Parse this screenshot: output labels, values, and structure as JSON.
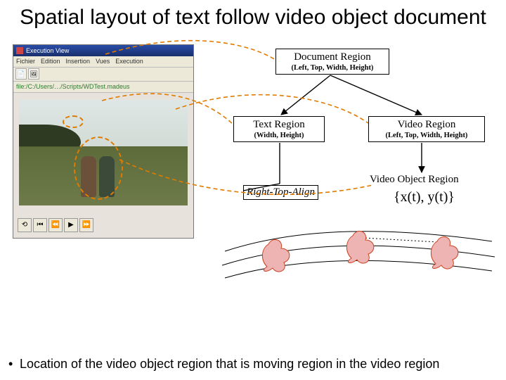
{
  "title": "Spatial layout of text follow video object document",
  "screenshot": {
    "window_title": "Execution View",
    "menu": [
      "Fichier",
      "Edition",
      "Insertion",
      "Vues",
      "Execution"
    ],
    "path_label": "file:/C:/Users/…/Scripts/WDTest.madeus",
    "controls": [
      "⟲",
      "⏮",
      "⏪",
      "▶",
      "⏩"
    ]
  },
  "boxes": {
    "document": {
      "title": "Document Region",
      "sub": "(Left, Top, Width, Height)"
    },
    "text": {
      "title": "Text Region",
      "sub": "(Width, Height)"
    },
    "video": {
      "title": "Video Region",
      "sub": "(Left, Top, Width, Height)"
    },
    "vobj": {
      "title": "Video Object Region",
      "coords": "{x(t), y(t)}"
    }
  },
  "align_label": "Right-Top-Align",
  "bullet": "Location of the video object region that is moving region in the video region"
}
